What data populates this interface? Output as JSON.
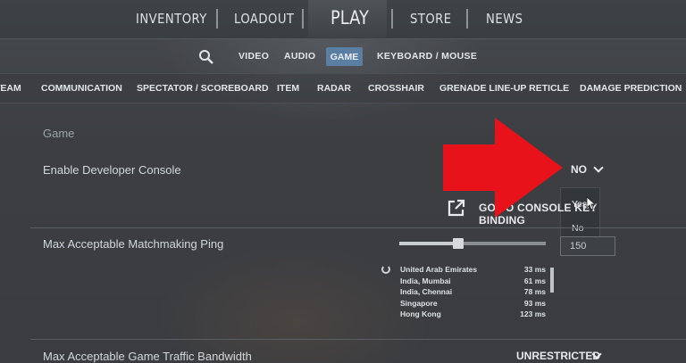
{
  "top_nav": {
    "items": [
      "INVENTORY",
      "LOADOUT",
      "PLAY",
      "STORE",
      "NEWS"
    ]
  },
  "sub_nav": {
    "items": [
      "VIDEO",
      "AUDIO",
      "GAME",
      "KEYBOARD / MOUSE"
    ],
    "active": "GAME"
  },
  "categories": [
    "TEAM",
    "COMMUNICATION",
    "SPECTATOR / SCOREBOARD",
    "ITEM",
    "RADAR",
    "CROSSHAIR",
    "GRENADE LINE-UP RETICLE",
    "DAMAGE PREDICTION"
  ],
  "section": {
    "title": "Game"
  },
  "settings": {
    "dev_console": {
      "label": "Enable Developer Console",
      "value": "NO",
      "options": [
        "Yes",
        "No"
      ],
      "hovered_option": "Yes"
    },
    "console_key_button": "GO TO CONSOLE KEY BINDING",
    "matchmaking_ping": {
      "label": "Max Acceptable Matchmaking Ping",
      "value": "150",
      "slider_fraction": 0.4
    },
    "bandwidth": {
      "label": "Max Acceptable Game Traffic Bandwidth",
      "value": "UNRESTRICTED"
    }
  },
  "ping_list": [
    {
      "name": "United Arab Emirates",
      "ms": "33 ms"
    },
    {
      "name": "India, Mumbai",
      "ms": "61 ms"
    },
    {
      "name": "India, Chennai",
      "ms": "78 ms"
    },
    {
      "name": "Singapore",
      "ms": "93 ms"
    },
    {
      "name": "Hong Kong",
      "ms": "123 ms"
    }
  ],
  "annotation_color": "#e8121a",
  "accent_color": "#5b7fa3"
}
